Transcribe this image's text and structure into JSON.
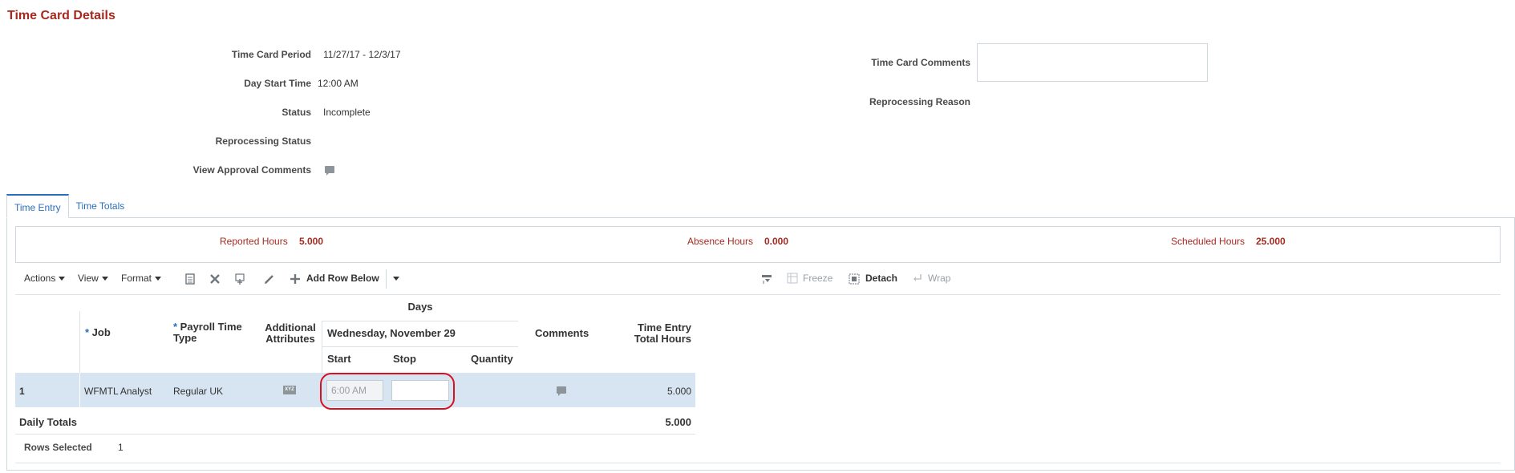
{
  "page": {
    "title": "Time Card Details"
  },
  "details": {
    "period_label": "Time Card Period",
    "period_value": "11/27/17 - 12/3/17",
    "day_start_label": "Day Start Time",
    "day_start_value": "12:00 AM",
    "status_label": "Status",
    "status_value": "Incomplete",
    "reprocessing_status_label": "Reprocessing Status",
    "view_approval_label": "View Approval Comments",
    "comments_label": "Time Card Comments",
    "comments_value": "",
    "reprocessing_reason_label": "Reprocessing Reason"
  },
  "tabs": [
    {
      "label": "Time Entry",
      "active": true
    },
    {
      "label": "Time Totals",
      "active": false
    }
  ],
  "summary": {
    "reported_label": "Reported Hours",
    "reported_value": "5.000",
    "absence_label": "Absence Hours",
    "absence_value": "0.000",
    "scheduled_label": "Scheduled Hours",
    "scheduled_value": "25.000"
  },
  "toolbar": {
    "actions": "Actions",
    "view": "View",
    "format": "Format",
    "add_row_below": "Add Row Below",
    "freeze": "Freeze",
    "detach": "Detach",
    "wrap": "Wrap"
  },
  "table": {
    "headers": {
      "job": "Job",
      "payroll_time_type_1": "Payroll Time",
      "payroll_time_type_2": "Type",
      "additional_1": "Additional",
      "additional_2": "Attributes",
      "days": "Days",
      "day_name": "Wednesday, November 29",
      "start": "Start",
      "stop": "Stop",
      "quantity": "Quantity",
      "comments": "Comments",
      "total_1": "Time Entry",
      "total_2": "Total Hours"
    },
    "rows": [
      {
        "num": "1",
        "job": "WFMTL Analyst",
        "payroll_type": "Regular UK",
        "attr_icon_text": "XYZ",
        "start": "6:00 AM",
        "stop": "",
        "quantity": "",
        "total": "5.000"
      }
    ],
    "totals_label": "Daily Totals",
    "totals_value": "5.000",
    "rows_selected_label": "Rows Selected",
    "rows_selected_value": "1"
  },
  "colors": {
    "title_red": "#a7291f",
    "link_blue": "#2a6ebb",
    "selected_row": "#d7e5f2",
    "highlight_red": "#d9101d"
  },
  "icons": {
    "approval_comments": "comment-bubble-icon",
    "row_comment": "comment-bubble-icon",
    "additional_attributes": "attributes-icon"
  }
}
